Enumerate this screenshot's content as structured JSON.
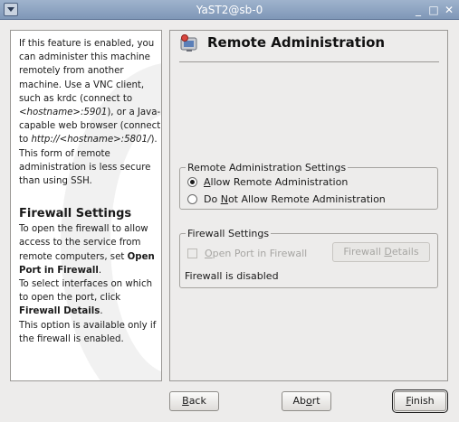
{
  "window": {
    "title": "YaST2@sb-0"
  },
  "help": {
    "paragraph_intro": "If this feature is enabled, you can administer this machine remotely from another machine. Use a VNC client, such as krdc (connect to <hostname>:5901), or a Java-capable web browser (connect to http://<hostname>:5801/). This form of remote administration is less secure than using SSH.",
    "heading_firewall": "Firewall Settings",
    "firewall_p1": "To open the firewall to allow access to the service from remote computers, set Open Port in Firewall.",
    "firewall_p2": "To select interfaces on which to open the port, click Firewall Details.",
    "firewall_p3": "This option is available only if the firewall is enabled."
  },
  "header": {
    "title": "Remote Administration",
    "icon": "remote-admin-icon"
  },
  "remote_settings": {
    "legend": "Remote Administration Settings",
    "allow_label": "Allow Remote Administration",
    "deny_label": "Do Not Allow Remote Administration",
    "selected": "allow"
  },
  "firewall_settings": {
    "legend": "Firewall Settings",
    "open_port_label": "Open Port in Firewall",
    "open_port_checked": false,
    "details_button": "Firewall Details",
    "status": "Firewall is disabled"
  },
  "buttons": {
    "back": "Back",
    "abort": "Abort",
    "finish": "Finish"
  }
}
